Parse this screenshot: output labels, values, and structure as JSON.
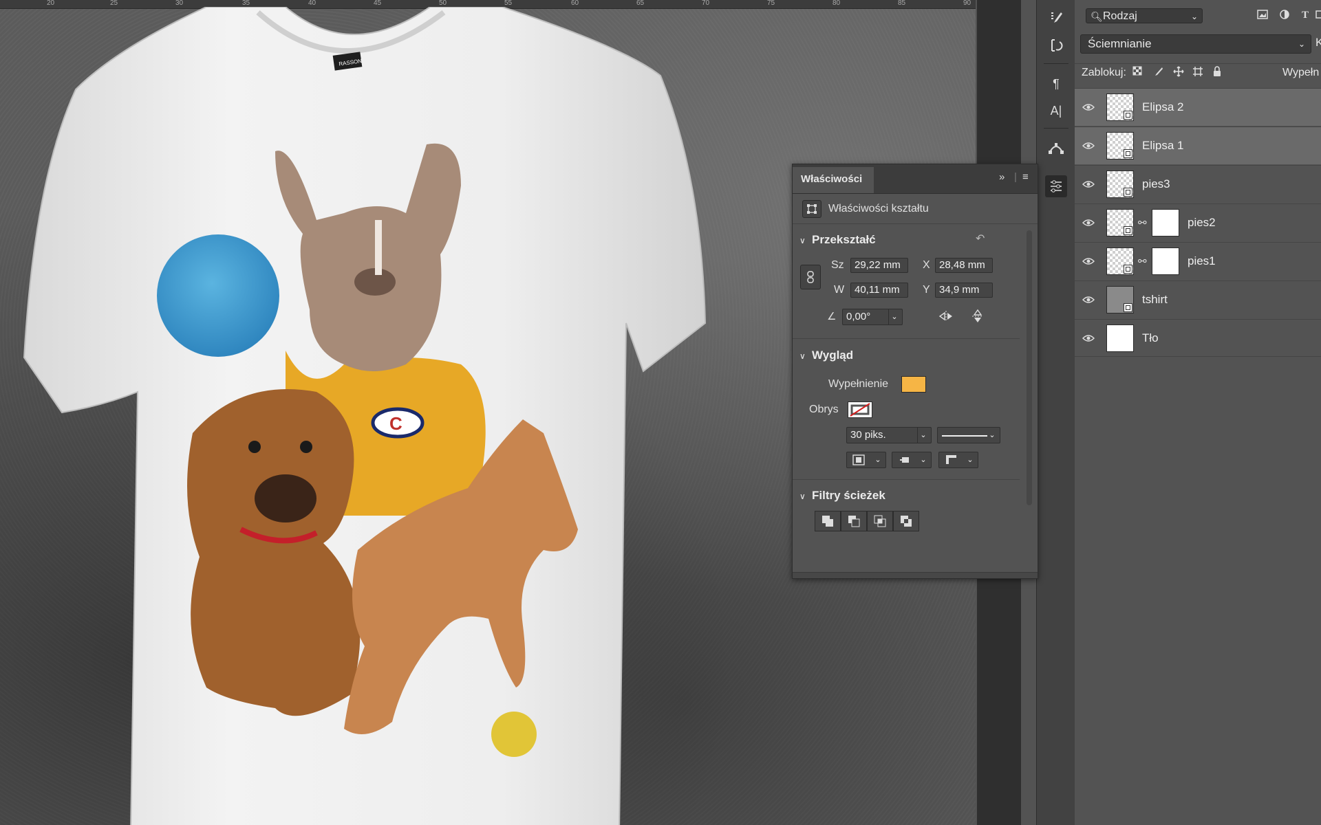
{
  "ruler": {
    "ticks": [
      "20",
      "25",
      "30",
      "35",
      "40",
      "45",
      "50",
      "55",
      "60",
      "65",
      "70",
      "75",
      "80",
      "85",
      "90"
    ]
  },
  "canvas": {
    "colors": {
      "blue_circle": "#3b9ad0",
      "yellow_circle": "#e1c537",
      "shirt": "#ececec",
      "sweater": "#e7a826"
    },
    "shirt_tag": "RASSON",
    "sweater_logo": "C"
  },
  "toolstrip": {
    "icons": [
      "brush-presets-icon",
      "history-brush-icon",
      "paragraph-icon",
      "character-icon",
      "paths-icon",
      "properties-icon"
    ],
    "glyphs": {
      "paragraph": "¶",
      "character": "A|"
    }
  },
  "layers_panel": {
    "kind_filter": "Rodzaj",
    "blend_mode": "Ściemnianie",
    "opacity_label_fragment": "K",
    "lock_label": "Zablokuj:",
    "fill_label_fragment": "Wypełn",
    "layers": [
      {
        "name": "Elipsa 2",
        "selected": true,
        "has_mask": false
      },
      {
        "name": "Elipsa 1",
        "selected": true,
        "has_mask": false
      },
      {
        "name": "pies3",
        "selected": false,
        "has_mask": false
      },
      {
        "name": "pies2",
        "selected": false,
        "has_mask": true
      },
      {
        "name": "pies1",
        "selected": false,
        "has_mask": true
      },
      {
        "name": "tshirt",
        "selected": false,
        "has_mask": false
      },
      {
        "name": "Tło",
        "selected": false,
        "has_mask": false
      }
    ]
  },
  "properties_panel": {
    "tab_title": "Właściwości",
    "subtitle": "Właściwości kształtu",
    "transform": {
      "title": "Przekształć",
      "width_label": "Sz",
      "width_value": "29,22 mm",
      "height_label": "W",
      "height_value": "40,11 mm",
      "x_label": "X",
      "x_value": "28,48 mm",
      "y_label": "Y",
      "y_value": "34,9 mm",
      "angle_value": "0,00°"
    },
    "appearance": {
      "title": "Wygląd",
      "fill_label": "Wypełnienie",
      "fill_color": "#f6b545",
      "stroke_label": "Obrys",
      "stroke_width": "30 piks."
    },
    "path_ops": {
      "title": "Filtry ścieżek"
    }
  }
}
